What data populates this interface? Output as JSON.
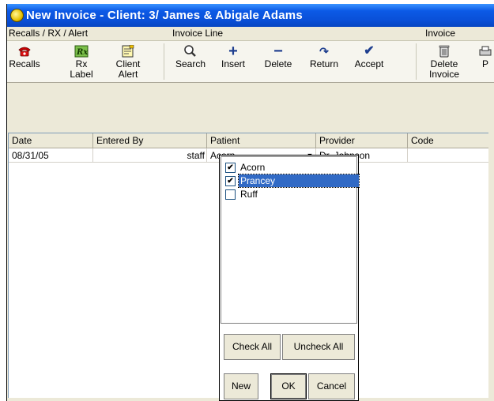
{
  "window": {
    "title": "New Invoice - Client: 3/  James & Abigale Adams"
  },
  "ribbon": {
    "groups": {
      "recalls": "Recalls / RX / Alert",
      "invoice_line": "Invoice Line",
      "invoice": "Invoice"
    },
    "buttons": {
      "recalls": {
        "label": "Recalls",
        "icon": "telephone-icon"
      },
      "rx_label": {
        "line1": "Rx",
        "line2": "Label",
        "icon": "rx-icon"
      },
      "client_alert": {
        "line1": "Client",
        "line2": "Alert",
        "icon": "alert-note-icon"
      },
      "search": {
        "label": "Search",
        "icon": "magnifier-icon"
      },
      "insert": {
        "label": "Insert",
        "icon": "plus-icon"
      },
      "delete": {
        "label": "Delete",
        "icon": "minus-icon"
      },
      "return": {
        "label": "Return",
        "icon": "return-arrow-icon"
      },
      "accept": {
        "label": "Accept",
        "icon": "checkmark-icon"
      },
      "delete_invoice": {
        "line1": "Delete",
        "line2": "Invoice",
        "icon": "trash-icon"
      },
      "partial": {
        "label": "P",
        "icon": "printer-icon"
      }
    }
  },
  "grid": {
    "columns": [
      "Date",
      "Entered By",
      "Patient",
      "Provider",
      "Code"
    ],
    "rows": [
      {
        "date": "08/31/05",
        "entered_by": "staff",
        "patient": "Acorn",
        "provider": "Dr. Johnson",
        "code": ""
      }
    ]
  },
  "patient_popup": {
    "items": [
      {
        "label": "Acorn",
        "checked": true,
        "selected": false
      },
      {
        "label": "Prancey",
        "checked": true,
        "selected": true
      },
      {
        "label": "Ruff",
        "checked": false,
        "selected": false
      }
    ],
    "check_all": "Check All",
    "uncheck_all": "Uncheck All",
    "new": "New",
    "ok": "OK",
    "cancel": "Cancel"
  },
  "colors": {
    "titlebar": "#0a50d8",
    "selection": "#316ac5",
    "face": "#ece9d8"
  }
}
